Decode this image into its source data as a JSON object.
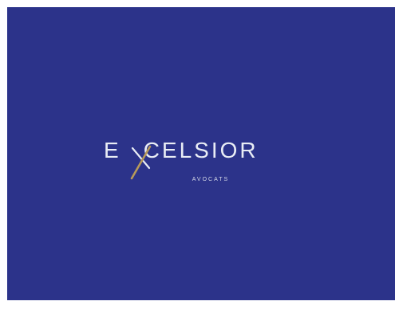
{
  "brand": {
    "name_prefix": "E",
    "name_suffix": "CELSIOR",
    "name_logo_letter": "X",
    "tagline": "AVOCATS"
  },
  "colors": {
    "background": "#2c338a",
    "wordmark": "#e9edf5",
    "accent": "#b79a5a"
  }
}
